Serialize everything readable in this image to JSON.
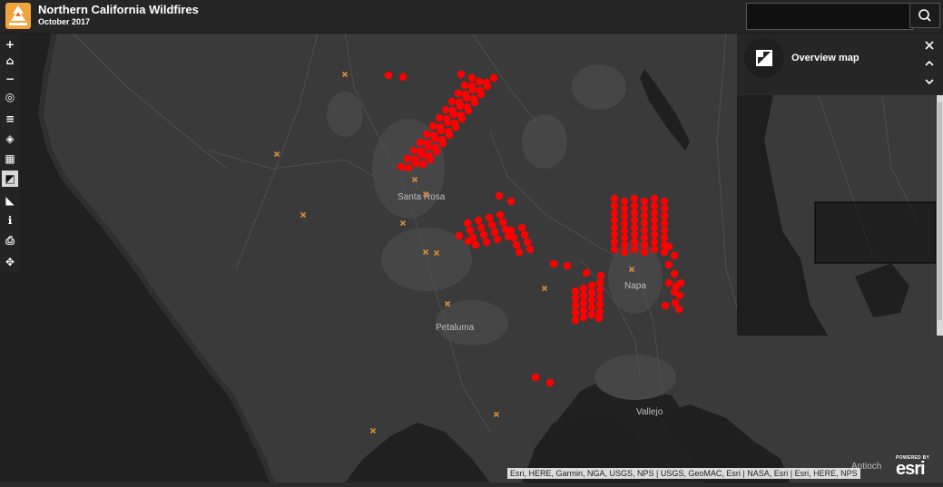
{
  "header": {
    "title": "Northern California Wildfires",
    "subtitle": "October 2017",
    "logo_icon": "wildfire-logo-icon",
    "search": {
      "placeholder": "",
      "icon": "search-icon"
    }
  },
  "toolbar": {
    "tools": [
      {
        "name": "zoom-in-icon",
        "glyph": "+"
      },
      {
        "name": "home-icon",
        "glyph": "⌂"
      },
      {
        "name": "zoom-out-icon",
        "glyph": "−"
      },
      {
        "name": "locate-icon",
        "glyph": "◎"
      },
      {
        "name": "legend-list-icon",
        "glyph": "≡"
      },
      {
        "name": "layers-icon",
        "glyph": "◈"
      },
      {
        "name": "basemap-gallery-icon",
        "glyph": "▦"
      },
      {
        "name": "overview-map-icon",
        "glyph": "◩",
        "active": true
      },
      {
        "name": "measure-icon",
        "glyph": "◣"
      },
      {
        "name": "info-icon",
        "glyph": "ℹ"
      },
      {
        "name": "print-icon",
        "glyph": "⎙"
      },
      {
        "name": "share-icon",
        "glyph": "✥"
      }
    ]
  },
  "panel": {
    "title": "Overview map",
    "icon": "overview-map-icon",
    "close_glyph": "✕",
    "up_glyph": "⌃",
    "down_glyph": "⌄"
  },
  "map": {
    "colors": {
      "land": "#3a3a3a",
      "water": "#1f1f1f",
      "fire": "#ff0000",
      "marker": "#d98a3a",
      "urban": "#484848"
    },
    "cities": [
      "Santa Rosa",
      "Petaluma",
      "Napa",
      "Vallejo",
      "Antioch"
    ]
  },
  "attribution": "Esri, HERE, Garmin, NGA, USGS, NPS | USGS, GeoMAC, Esri | NASA, Esri | Esri, HERE, NPS",
  "esri": {
    "powered": "POWERED BY",
    "word": "esri"
  }
}
